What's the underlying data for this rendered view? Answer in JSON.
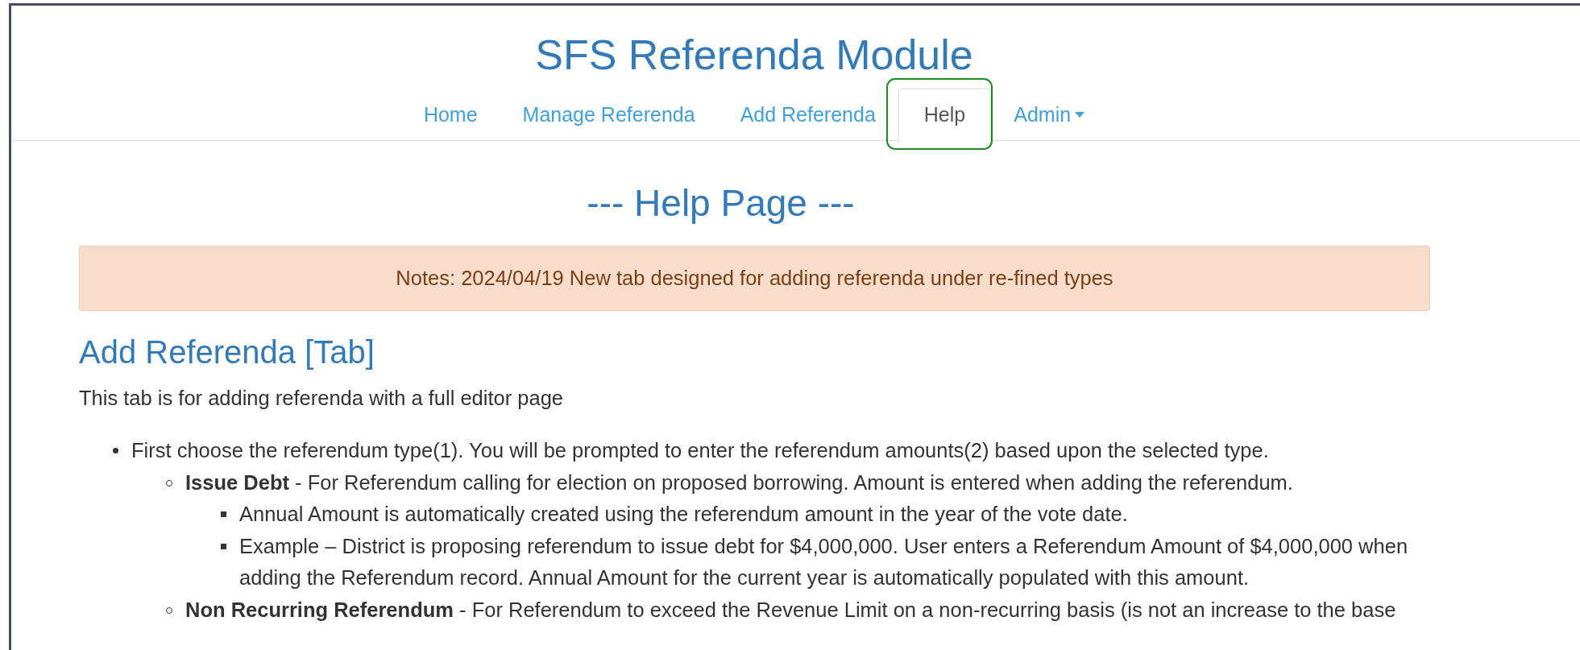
{
  "title": "SFS Referenda Module",
  "nav": [
    {
      "label": "Home",
      "selected": false,
      "kind": "link"
    },
    {
      "label": "Manage Referenda",
      "selected": false,
      "kind": "link"
    },
    {
      "label": "Add Referenda",
      "selected": false,
      "kind": "link"
    },
    {
      "label": "Help",
      "selected": true,
      "kind": "link"
    },
    {
      "label": "Admin",
      "selected": false,
      "kind": "dropdown"
    }
  ],
  "page_heading": "--- Help Page ---",
  "notice": "Notes: 2024/04/19 New tab designed for adding referenda under re-fined types",
  "section": {
    "heading": "Add Referenda [Tab]",
    "intro": "This tab is for adding referenda with a full editor page",
    "list": [
      {
        "text": "First choose the referendum type(1). You will be prompted to enter the referendum amounts(2) based upon the selected type.",
        "children": [
          {
            "text": "**Issue Debt** - For Referendum calling for election on proposed borrowing. Amount is entered when adding the referendum.",
            "children": [
              {
                "text": "Annual Amount is automatically created using the referendum amount in the year of the vote date."
              },
              {
                "text": "Example – District is proposing referendum to issue debt for $4,000,000. User enters a Referendum Amount of $4,000,000 when adding the Referendum record. Annual Amount for the current year is automatically populated with this amount."
              }
            ]
          },
          {
            "text": "**Non Recurring Referendum** - For Referendum to exceed the Revenue Limit on a non-recurring basis (is not an increase to the base"
          }
        ]
      }
    ]
  }
}
